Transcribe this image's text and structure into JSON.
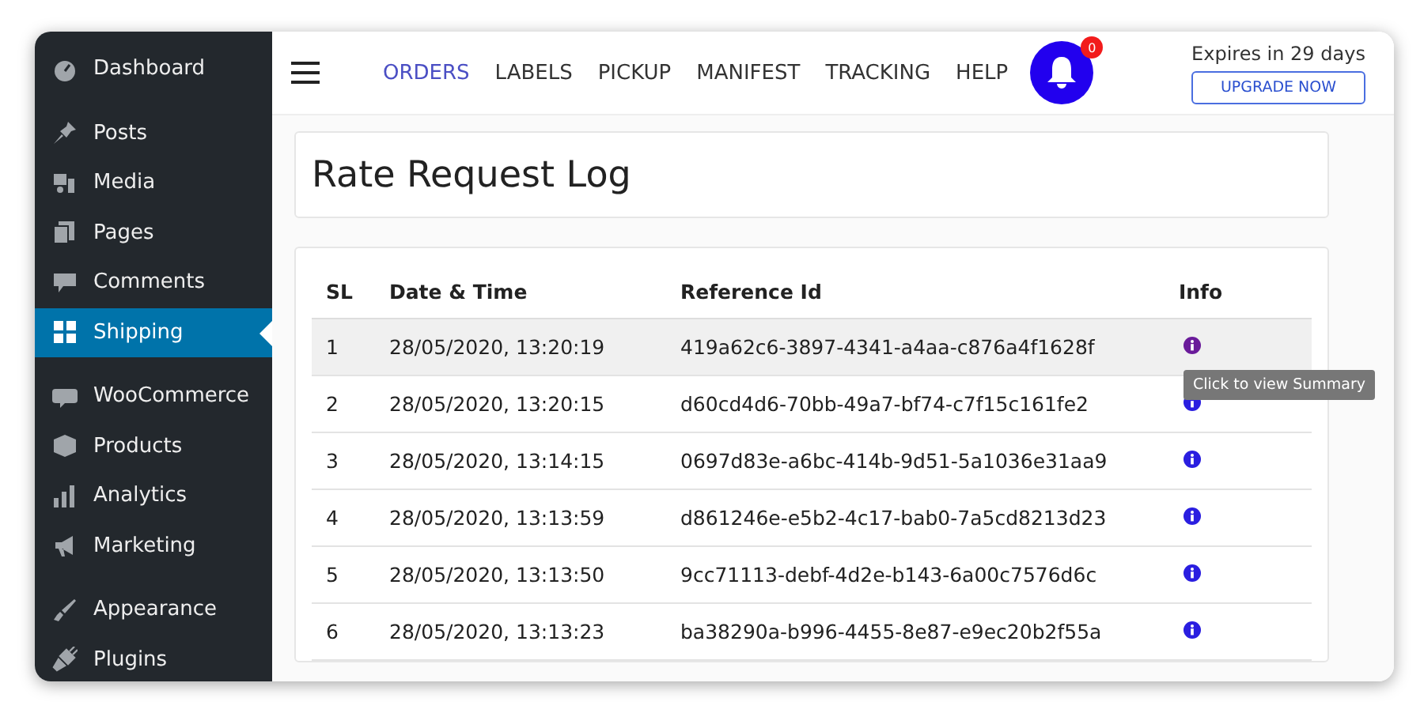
{
  "sidebar": {
    "groups": [
      [
        {
          "label": "Dashboard",
          "selected": false
        }
      ],
      [
        {
          "label": "Posts",
          "selected": false
        },
        {
          "label": "Media",
          "selected": false
        },
        {
          "label": "Pages",
          "selected": false
        },
        {
          "label": "Comments",
          "selected": false
        },
        {
          "label": "Shipping",
          "selected": true
        }
      ],
      [
        {
          "label": "WooCommerce",
          "selected": false
        },
        {
          "label": "Products",
          "selected": false
        },
        {
          "label": "Analytics",
          "selected": false
        },
        {
          "label": "Marketing",
          "selected": false
        }
      ],
      [
        {
          "label": "Appearance",
          "selected": false
        },
        {
          "label": "Plugins",
          "selected": false
        }
      ]
    ]
  },
  "nav": {
    "tabs": [
      {
        "label": "ORDERS",
        "selected": true
      },
      {
        "label": "LABELS",
        "selected": false
      },
      {
        "label": "PICKUP",
        "selected": false
      },
      {
        "label": "MANIFEST",
        "selected": false
      },
      {
        "label": "TRACKING",
        "selected": false
      },
      {
        "label": "HELP",
        "selected": false
      }
    ],
    "notification_count": "0",
    "expiry": "Expires in 29 days",
    "upgrade_button": "UPGRADE NOW"
  },
  "page_title": "Rate Request Log",
  "table": {
    "columns": [
      "SL",
      "Date & Time",
      "Reference Id",
      "Info"
    ],
    "rows": [
      {
        "sl": "1",
        "datetime": "28/05/2020, 13:20:19",
        "reference": "419a62c6-3897-4341-a4aa-c876a4f1628f",
        "highlighted": true,
        "visited": true
      },
      {
        "sl": "2",
        "datetime": "28/05/2020, 13:20:15",
        "reference": "d60cd4d6-70bb-49a7-bf74-c7f15c161fe2",
        "highlighted": false,
        "visited": false
      },
      {
        "sl": "3",
        "datetime": "28/05/2020, 13:14:15",
        "reference": "0697d83e-a6bc-414b-9d51-5a1036e31aa9",
        "highlighted": false,
        "visited": false
      },
      {
        "sl": "4",
        "datetime": "28/05/2020, 13:13:59",
        "reference": "d861246e-e5b2-4c17-bab0-7a5cd8213d23",
        "highlighted": false,
        "visited": false
      },
      {
        "sl": "5",
        "datetime": "28/05/2020, 13:13:50",
        "reference": "9cc71113-debf-4d2e-b143-6a00c7576d6c",
        "highlighted": false,
        "visited": false
      },
      {
        "sl": "6",
        "datetime": "28/05/2020, 13:13:23",
        "reference": "ba38290a-b996-4455-8e87-e9ec20b2f55a",
        "highlighted": false,
        "visited": false
      }
    ]
  },
  "tooltip": {
    "text": "Click to view Summary"
  }
}
